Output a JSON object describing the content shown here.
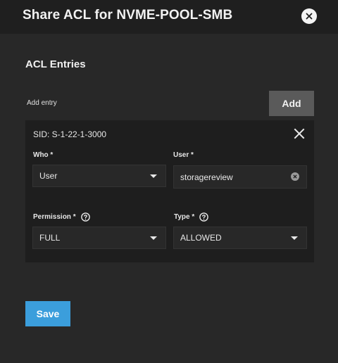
{
  "dialog": {
    "title": "Share ACL for NVME-POOL-SMB",
    "close_icon": "close-circle-icon"
  },
  "acl": {
    "section_title": "ACL Entries",
    "add_entry_label": "Add entry",
    "add_button": "Add",
    "entries": [
      {
        "sid": "SID: S-1-22-1-3000",
        "remove_icon": "close-icon",
        "who": {
          "label": "Who *",
          "value": "User"
        },
        "user": {
          "label": "User *",
          "value": "storagereview"
        },
        "permission": {
          "label": "Permission *",
          "value": "FULL",
          "help_icon": "help-circle-icon"
        },
        "type": {
          "label": "Type *",
          "value": "ALLOWED",
          "help_icon": "help-circle-icon"
        }
      }
    ]
  },
  "footer": {
    "save_button": "Save"
  },
  "colors": {
    "background": "#282828",
    "header": "#1f1f1f",
    "entry_panel": "#1e1e1e",
    "primary": "#3b9edc",
    "secondary_button": "#5a5a5a"
  }
}
